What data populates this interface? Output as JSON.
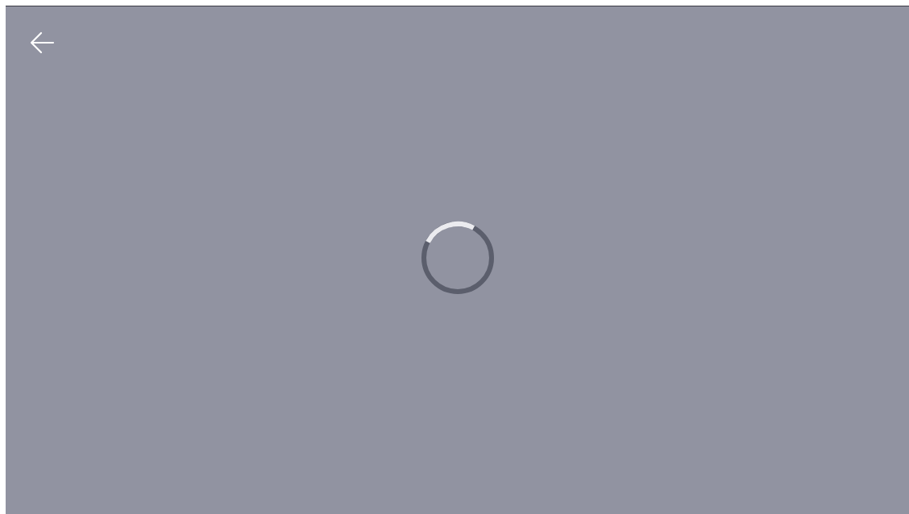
{
  "screen": {
    "loading": true,
    "back_button": {
      "disabled": false
    }
  }
}
